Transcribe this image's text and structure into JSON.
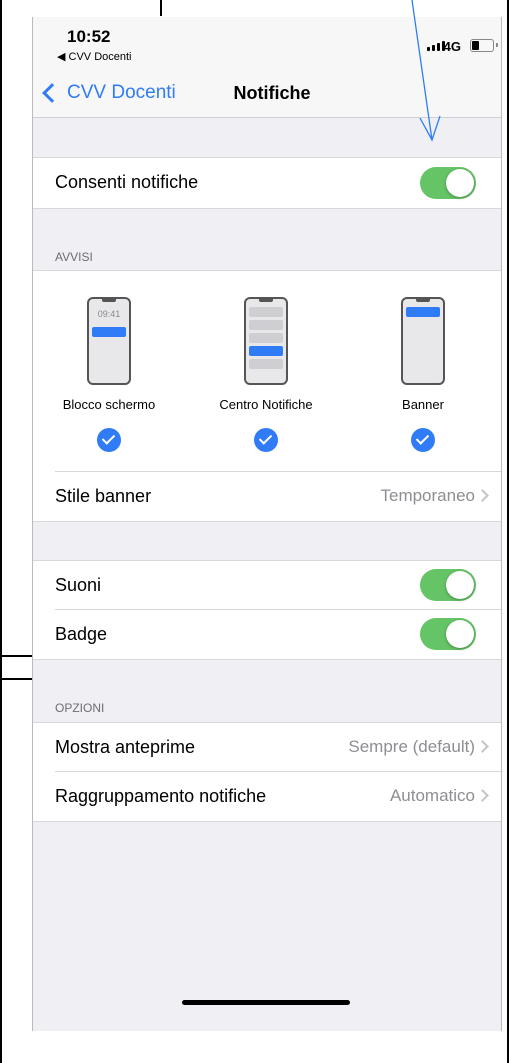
{
  "status_bar": {
    "time": "10:52",
    "back_app": "◀ CVV Docenti",
    "network": "4G"
  },
  "nav": {
    "back_label": "CVV Docenti",
    "title": "Notifiche"
  },
  "allow": {
    "label": "Consenti notifiche",
    "enabled": true
  },
  "alerts": {
    "header": "AVVISI",
    "items": [
      {
        "label": "Blocco schermo",
        "preview_time": "09:41",
        "checked": true
      },
      {
        "label": "Centro Notifiche",
        "checked": true
      },
      {
        "label": "Banner",
        "checked": true
      }
    ],
    "banner_style": {
      "label": "Stile banner",
      "value": "Temporaneo"
    }
  },
  "sounds": {
    "label": "Suoni",
    "enabled": true
  },
  "badge": {
    "label": "Badge",
    "enabled": true
  },
  "options": {
    "header": "OPZIONI",
    "show_previews": {
      "label": "Mostra anteprime",
      "value": "Sempre (default)"
    },
    "grouping": {
      "label": "Raggruppamento notifiche",
      "value": "Automatico"
    }
  },
  "colors": {
    "accent": "#2f7cf6",
    "toggle_on": "#65c466",
    "background": "#efeff4"
  }
}
